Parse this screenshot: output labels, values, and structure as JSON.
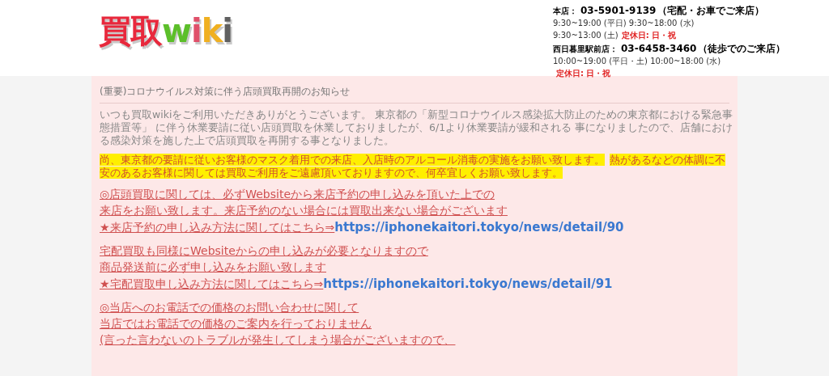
{
  "logo": {
    "parts": [
      {
        "text": "買取",
        "color": "#e8283c"
      },
      {
        "text": "w",
        "color": "#5cbf2a"
      },
      {
        "text": "i",
        "color": "#e0506a"
      },
      {
        "text": "k",
        "color": "#f0b020"
      },
      {
        "text": "i",
        "color": "#606060"
      }
    ]
  },
  "stores": [
    {
      "name": "本店：",
      "phone": "03-5901-9139",
      "note": "（宅配・お車でご来店）",
      "hours": [
        "9:30~19:00 (平日) 9:30~18:00 (水)",
        "9:30~13:00 (土)"
      ],
      "closed": "定休日: 日・祝"
    },
    {
      "name": "西日暮里駅前店：",
      "phone": "03-6458-3460",
      "note": "（徒歩でのご来店）",
      "hours": [
        "10:00~19:00 (平日・土) 10:00~18:00 (水)"
      ],
      "closed": "定休日: 日・祝"
    }
  ],
  "notice": {
    "title": "(重要)コロナウイルス対策に伴う店頭買取再開のお知らせ",
    "intro": "いつも買取wikiをご利用いただきありがとうございます。 東京都の「新型コロナウイルス感染拡大防止のための東京都における緊急事態措置等」 に伴う休業要請に従い店頭買取を休業しておりましたが、6/1より休業要請が緩和される 事になりましたので、店舗における感染対策を施した上で店頭買取を再開する事となりました。",
    "highlights": [
      "尚、東京都の要請に従いお客様のマスク着用での来店、入店時のアルコール消毒の実施をお願い致します。",
      "熱があるなどの体調に不安のあるお客様に関しては買取ご利用をご遠慮頂いておりますので、何卒宜しくお願い致します。"
    ],
    "blocks": [
      [
        {
          "text": "◎店頭買取に関しては、必ずWebsiteから来店予約の申し込みを頂いた上での"
        },
        {
          "text": "来店をお願い致します。来店予約のない場合には買取出来ない場合がございます"
        },
        {
          "text": "★来店予約の申し込み方法に関してはこちら⇒",
          "link": "https://iphonekaitori.tokyo/news/detail/90"
        }
      ],
      [
        {
          "text": "宅配買取も同様にWebsiteからの申し込みが必要となりますので"
        },
        {
          "text": "商品発送前に必ず申し込みをお願い致します"
        },
        {
          "text": "★宅配買取申し込み方法に関してはこちら⇒",
          "link": "https://iphonekaitori.tokyo/news/detail/91"
        }
      ],
      [
        {
          "text": "◎当店へのお電話での価格のお問い合わせに関して"
        },
        {
          "text": "当店ではお電話での価格のご案内を行っておりません"
        },
        {
          "text": "(言った言わないのトラブルが発生してしまう場合がございますので、"
        }
      ]
    ]
  }
}
